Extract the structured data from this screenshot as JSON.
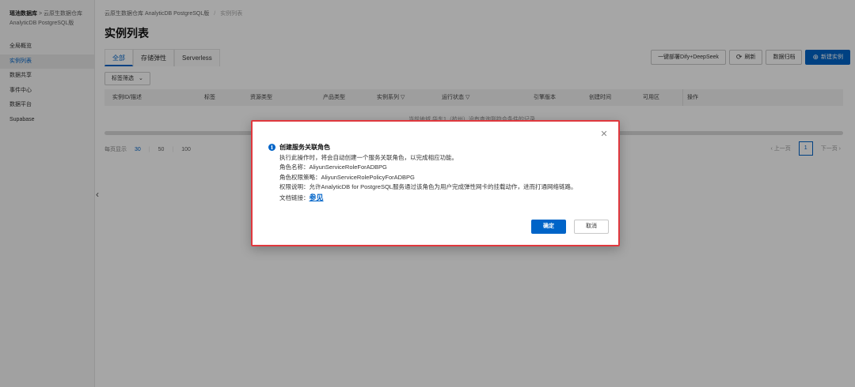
{
  "sidebar": {
    "title_bold": "瑶池数据库",
    "title_rest": " > 云原生数据仓库 AnalyticDB PostgreSQL版",
    "items": [
      {
        "label": "全局概览"
      },
      {
        "label": "实例列表"
      },
      {
        "label": "数据共享"
      },
      {
        "label": "事件中心"
      },
      {
        "label": "数据平台"
      },
      {
        "label": "Supabase"
      }
    ]
  },
  "breadcrumb": {
    "first": "云原生数据仓库 AnalyticDB PostgreSQL版",
    "sep": "/",
    "current": "实例列表"
  },
  "page": {
    "title": "实例列表"
  },
  "tabs": [
    {
      "label": "全部"
    },
    {
      "label": "存储弹性"
    },
    {
      "label": "Serverless"
    }
  ],
  "toolbar": {
    "dify_label": "一键部署Dify+DeepSeek",
    "refresh_label": "刷新",
    "diagnose_label": "数据归档",
    "create_label": "新建实例"
  },
  "filter": {
    "label": "标签筛选"
  },
  "table": {
    "columns": [
      "实例ID/描述",
      "标签",
      "资源类型",
      "产品类型",
      "实例系列",
      "运行状态",
      "引擎版本",
      "创建时间",
      "可用区",
      "操作"
    ],
    "empty_text": "当前地域 华东1（杭州）没有查询到符合条件的记录"
  },
  "pager": {
    "per_page_label": "每页显示",
    "sizes": [
      "30",
      "50",
      "100"
    ],
    "prev": "上一页",
    "page": "1",
    "next": "下一页"
  },
  "modal": {
    "title": "创建服务关联角色",
    "line1": "执行此操作时，将会自动创建一个服务关联角色，以完成相应功能。",
    "line2": "角色名称：AliyunServiceRoleForADBPG",
    "line3": "角色权限策略：AliyunServiceRolePolicyForADBPG",
    "line4": "权限说明：允许AnalyticDB for PostgreSQL服务通过该角色为用户完成弹性网卡的挂载动作，进而打通网络链路。",
    "line5_prefix": "文档链接：",
    "link_text": "参见",
    "ok_label": "确定",
    "cancel_label": "取消"
  },
  "colors": {
    "accent": "#0064c8",
    "highlight_border": "#e0383e"
  }
}
